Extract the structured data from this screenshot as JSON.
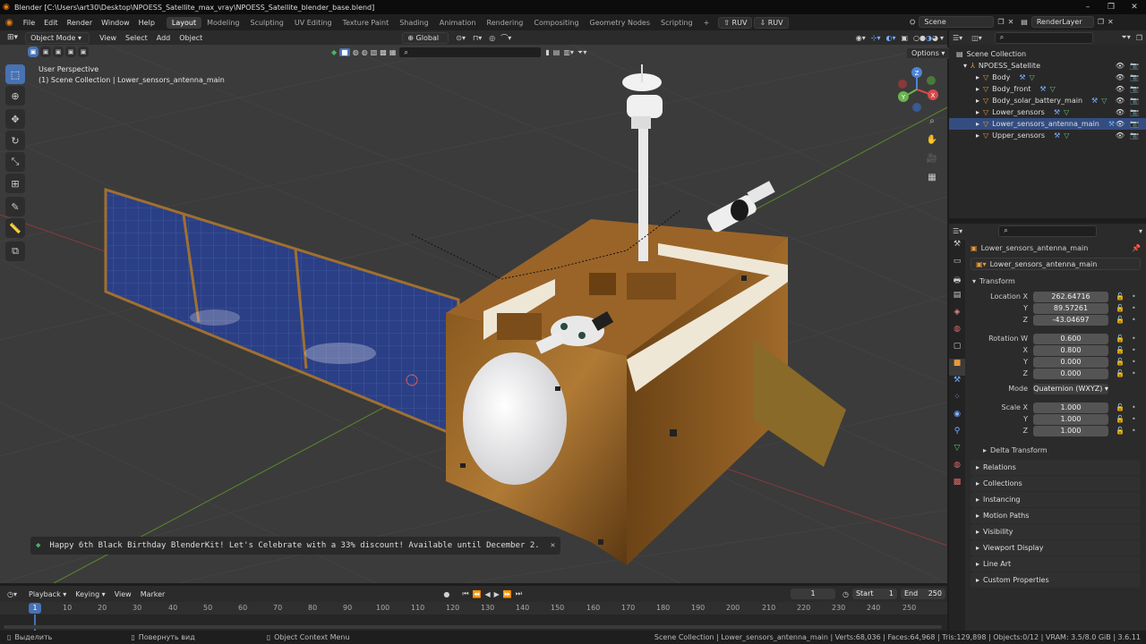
{
  "titlebar": {
    "title": "Blender [C:\\Users\\art30\\Desktop\\NPOESS_Satellite_max_vray\\NPOESS_Satellite_blender_base.blend]"
  },
  "menu": [
    "File",
    "Edit",
    "Render",
    "Window",
    "Help"
  ],
  "workspaces": [
    "Layout",
    "Modeling",
    "Sculpting",
    "UV Editing",
    "Texture Paint",
    "Shading",
    "Animation",
    "Rendering",
    "Compositing",
    "Geometry Nodes",
    "Scripting"
  ],
  "addon_buttons": [
    "RUV",
    "RUV"
  ],
  "scene": {
    "name": "Scene",
    "render_layer": "RenderLayer"
  },
  "viewport": {
    "mode": "Object Mode",
    "menus": [
      "View",
      "Select",
      "Add",
      "Object"
    ],
    "orientation": "Global",
    "options_label": "Options",
    "overlay_line1": "User Perspective",
    "overlay_line2": "(1) Scene Collection | Lower_sensors_antenna_main",
    "notification": "Happy 6th Black Birthday BlenderKit! Let's Celebrate with a 33% discount! Available until December 2."
  },
  "outliner": {
    "root": "Scene Collection",
    "collection": "NPOESS_Satellite",
    "items": [
      "Body",
      "Body_front",
      "Body_solar_battery_main",
      "Lower_sensors",
      "Lower_sensors_antenna_main",
      "Upper_sensors"
    ]
  },
  "properties": {
    "object_name": "Lower_sensors_antenna_main",
    "data_name": "Lower_sensors_antenna_main",
    "transform_label": "Transform",
    "location": {
      "label": "Location X",
      "x": "262.64716",
      "y": "89.57261",
      "z": "-43.04697"
    },
    "rotation": {
      "label": "Rotation W",
      "w": "0.600",
      "x": "0.800",
      "y": "0.000",
      "z": "0.000"
    },
    "mode_label": "Mode",
    "mode_value": "Quaternion (WXYZ)",
    "scale": {
      "label": "Scale X",
      "x": "1.000",
      "y": "1.000",
      "z": "1.000"
    },
    "delta": "Delta Transform",
    "panels": [
      "Relations",
      "Collections",
      "Instancing",
      "Motion Paths",
      "Visibility",
      "Viewport Display",
      "Line Art",
      "Custom Properties"
    ]
  },
  "timeline": {
    "menus": [
      "Playback",
      "Keying",
      "View",
      "Marker"
    ],
    "current_frame": "1",
    "start_label": "Start",
    "start": "1",
    "end_label": "End",
    "end": "250",
    "ticks": [
      "1",
      "10",
      "20",
      "30",
      "40",
      "50",
      "60",
      "70",
      "80",
      "90",
      "100",
      "110",
      "120",
      "130",
      "140",
      "150",
      "160",
      "170",
      "180",
      "190",
      "200",
      "210",
      "220",
      "230",
      "240",
      "250"
    ]
  },
  "statusbar": {
    "left1": "Выделить",
    "left2": "Повернуть вид",
    "left3": "Object Context Menu",
    "right": "Scene Collection | Lower_sensors_antenna_main | Verts:68,036 | Faces:64,968 | Tris:129,898 | Objects:0/12 | VRAM: 3.5/8.0 GiB | 3.6.11"
  },
  "labels": {
    "x": "X",
    "y": "Y",
    "z": "Z",
    "w": "W"
  },
  "colors": {
    "accent": "#4772b3",
    "orange": "#e89a3c",
    "green": "#62c47a"
  }
}
